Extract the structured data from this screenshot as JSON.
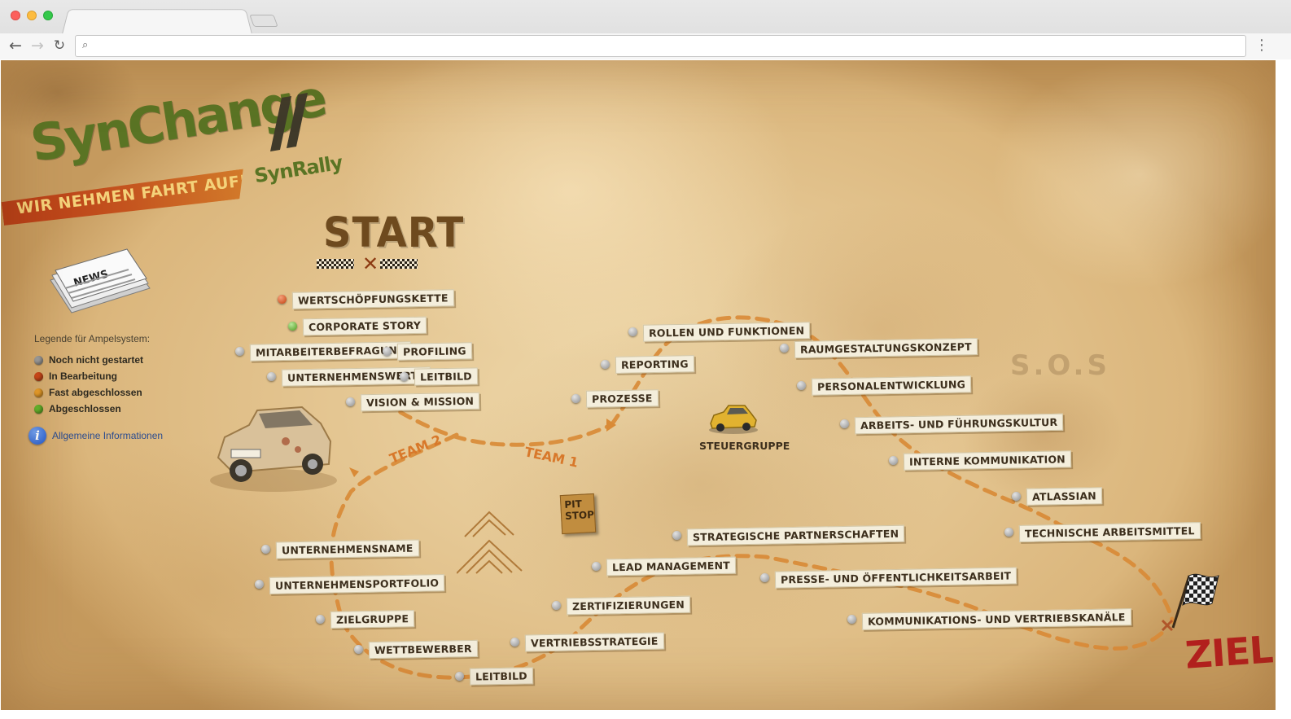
{
  "browser": {
    "url": ""
  },
  "brand": {
    "name": "SynChange",
    "sub": "SynRally",
    "slogan": "WIR NEHMEN FAHRT AUF!"
  },
  "legend": {
    "title": "Legende für Ampelsystem:",
    "items": [
      {
        "label": "Noch nicht gestartet",
        "color": "#9a9a9a"
      },
      {
        "label": "In Bearbeitung",
        "color": "#c9471a"
      },
      {
        "label": "Fast abgeschlossen",
        "color": "#e39a2a"
      },
      {
        "label": "Abgeschlossen",
        "color": "#62b22c"
      }
    ]
  },
  "info_link": "Allgemeine Informationen",
  "start_label": "START",
  "finish_label": "ZIEL",
  "teams": {
    "team1": "TEAM 1",
    "team2": "TEAM 2"
  },
  "steuergruppe": "STEUERGRUPPE",
  "pit_stop": "PIT STOP",
  "sos": "S.O.S",
  "stations": {
    "s1": {
      "label": "WERTSCHÖPFUNGSKETTE",
      "status": "in-bearbeitung"
    },
    "s2": {
      "label": "CORPORATE STORY",
      "status": "abgeschlossen"
    },
    "s3": {
      "label": "MITARBEITERBEFRAGUNG",
      "status": "noch-nicht-gestartet"
    },
    "s4": {
      "label": "PROFILING",
      "status": "noch-nicht-gestartet"
    },
    "s5": {
      "label": "UNTERNEHMENSWERTE",
      "status": "noch-nicht-gestartet"
    },
    "s6": {
      "label": "LEITBILD",
      "status": "noch-nicht-gestartet"
    },
    "s7": {
      "label": "VISION & MISSION",
      "status": "noch-nicht-gestartet"
    },
    "s8": {
      "label": "ROLLEN UND FUNKTIONEN",
      "status": "noch-nicht-gestartet"
    },
    "s9": {
      "label": "RAUMGESTALTUNGSKONZEPT",
      "status": "noch-nicht-gestartet"
    },
    "s10": {
      "label": "REPORTING",
      "status": "noch-nicht-gestartet"
    },
    "s11": {
      "label": "PERSONALENTWICKLUNG",
      "status": "noch-nicht-gestartet"
    },
    "s12": {
      "label": "PROZESSE",
      "status": "noch-nicht-gestartet"
    },
    "s13": {
      "label": "ARBEITS- UND FÜHRUNGSKULTUR",
      "status": "noch-nicht-gestartet"
    },
    "s14": {
      "label": "INTERNE KOMMUNIKATION",
      "status": "noch-nicht-gestartet"
    },
    "s15": {
      "label": "ATLASSIAN",
      "status": "noch-nicht-gestartet"
    },
    "s16": {
      "label": "TECHNISCHE ARBEITSMITTEL",
      "status": "noch-nicht-gestartet"
    },
    "s17": {
      "label": "STRATEGISCHE PARTNERSCHAFTEN",
      "status": "noch-nicht-gestartet"
    },
    "s18": {
      "label": "LEAD MANAGEMENT",
      "status": "noch-nicht-gestartet"
    },
    "s19": {
      "label": "PRESSE- UND ÖFFENTLICHKEITSARBEIT",
      "status": "noch-nicht-gestartet"
    },
    "s20": {
      "label": "ZERTIFIZIERUNGEN",
      "status": "noch-nicht-gestartet"
    },
    "s21": {
      "label": "KOMMUNIKATIONS- UND VERTRIEBSKANÄLE",
      "status": "noch-nicht-gestartet"
    },
    "s22": {
      "label": "VERTRIEBSSTRATEGIE",
      "status": "noch-nicht-gestartet"
    },
    "s23": {
      "label": "UNTERNEHMENSNAME",
      "status": "noch-nicht-gestartet"
    },
    "s24": {
      "label": "UNTERNEHMENSPORTFOLIO",
      "status": "noch-nicht-gestartet"
    },
    "s25": {
      "label": "ZIELGRUPPE",
      "status": "noch-nicht-gestartet"
    },
    "s26": {
      "label": "WETTBEWERBER",
      "status": "noch-nicht-gestartet"
    },
    "s27": {
      "label": "LEITBILD",
      "status": "noch-nicht-gestartet"
    }
  }
}
